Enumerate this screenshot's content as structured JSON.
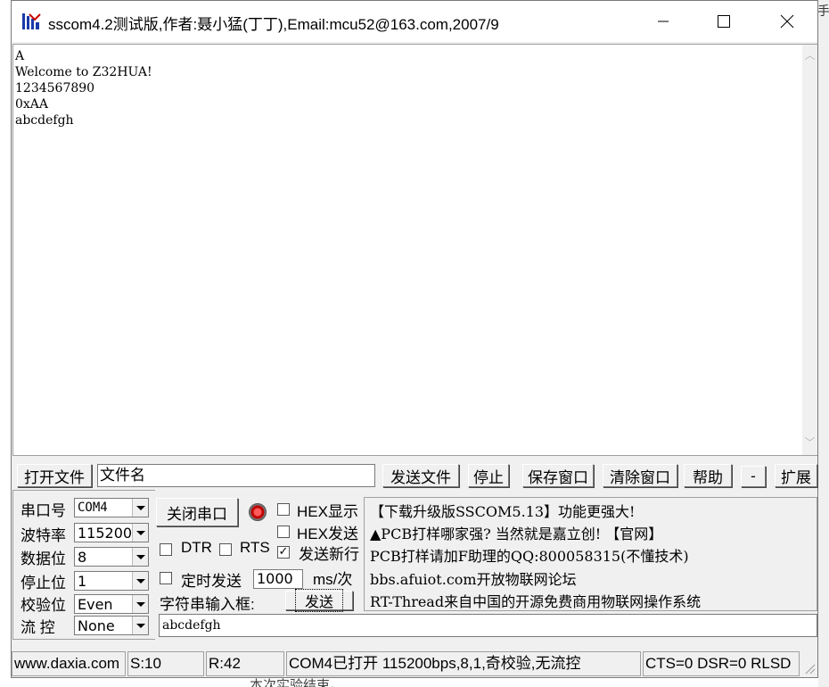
{
  "window": {
    "title": "sscom4.2测试版,作者:聂小猛(丁丁),Email:mcu52@163.com,2007/9"
  },
  "output": {
    "lines": [
      "A",
      "Welcome to Z32HUA!",
      "1234567890",
      "0xAA",
      "abcdefgh"
    ]
  },
  "toolbar": {
    "open_file": "打开文件",
    "filename": "文件名",
    "send_file": "发送文件",
    "stop": "停止",
    "save_window": "保存窗口",
    "clear_window": "清除窗口",
    "help": "帮助",
    "minus": "-",
    "expand": "扩展"
  },
  "config": {
    "port_label": "串口号",
    "port_value": "COM4",
    "baud_label": "波特率",
    "baud_value": "115200",
    "databits_label": "数据位",
    "databits_value": "8",
    "stopbits_label": "停止位",
    "stopbits_value": "1",
    "parity_label": "校验位",
    "parity_value": "Even",
    "flow_label": "流 控",
    "flow_value": "None"
  },
  "controls": {
    "close_port": "关闭串口",
    "hex_display": "HEX显示",
    "hex_display_checked": false,
    "hex_send": "HEX发送",
    "hex_send_checked": false,
    "dtr": "DTR",
    "dtr_checked": false,
    "rts": "RTS",
    "rts_checked": false,
    "send_newline": "发送新行",
    "send_newline_checked": true,
    "timed_send": "定时发送",
    "timed_send_checked": false,
    "interval": "1000",
    "interval_unit": "ms/次",
    "string_input_label": "字符串输入框:",
    "send": "发送"
  },
  "info": {
    "line1": "【下载升级版SSCOM5.13】功能更强大!",
    "line2": "▲PCB打样哪家强? 当然就是嘉立创! 【官网】",
    "line3": "PCB打样请加F助理的QQ:800058315(不懂技术)",
    "line4": "bbs.afuiot.com开放物联网论坛",
    "line5": "RT-Thread来自中国的开源免费商用物联网操作系统"
  },
  "send_text": "abcdefgh",
  "status": {
    "site": "www.daxia.com",
    "sent": "S:10",
    "received": "R:42",
    "port_state": "COM4已打开  115200bps,8,1,奇校验,无流控",
    "signals": "CTS=0 DSR=0 RLSD"
  },
  "background": {
    "right_char": "手",
    "bottom_text": "本次实验结束。"
  }
}
